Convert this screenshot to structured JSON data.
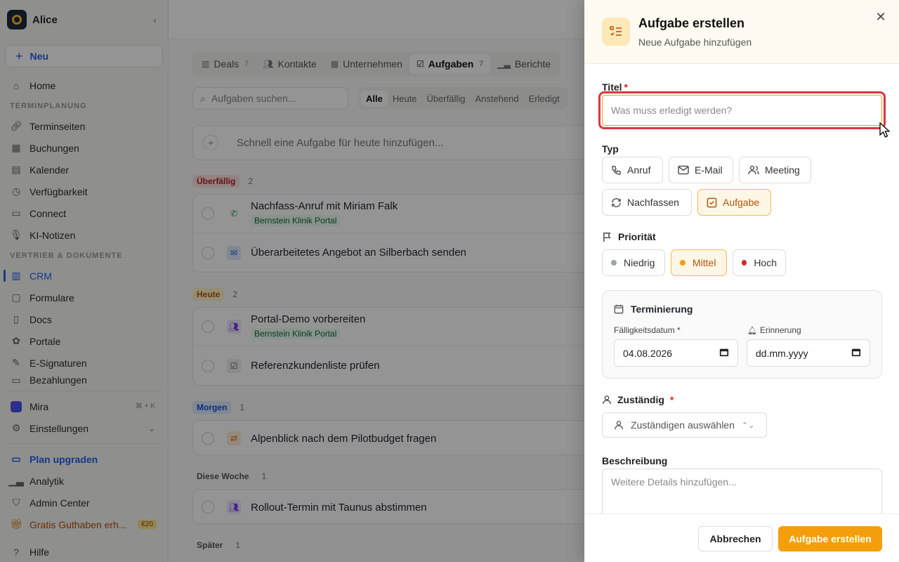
{
  "workspace": {
    "name": "Alice"
  },
  "sidebar": {
    "new_label": "Neu",
    "home": "Home",
    "section_scheduling": "TERMINPLANUNG",
    "scheduling_items": [
      "Terminseiten",
      "Buchungen",
      "Kalender",
      "Verfügbarkeit",
      "Connect",
      "KI-Notizen"
    ],
    "section_sales": "VERTRIEB & DOKUMENTE",
    "sales_items": [
      "CRM",
      "Formulare",
      "Docs",
      "Portale",
      "E-Signaturen",
      "Bezahlungen"
    ],
    "mira": "Mira",
    "mira_shortcut": "⌘ + K",
    "settings": "Einstellungen",
    "upgrade": "Plan upgraden",
    "analytics": "Analytik",
    "admin": "Admin Center",
    "credit": "Gratis Guthaben erh...",
    "credit_badge": "€20",
    "help": "Hilfe"
  },
  "crm": {
    "tabs": [
      {
        "label": "Deals",
        "count": "7"
      },
      {
        "label": "Kontakte",
        "count": ""
      },
      {
        "label": "Unternehmen",
        "count": ""
      },
      {
        "label": "Aufgaben",
        "count": "7"
      },
      {
        "label": "Berichte",
        "count": ""
      }
    ],
    "search_placeholder": "Aufgaben suchen...",
    "filters": [
      "Alle",
      "Heute",
      "Überfällig",
      "Anstehend",
      "Erledigt"
    ],
    "quick_add": "Schnell eine Aufgabe für heute hinzufügen...",
    "groups": [
      {
        "label": "Überfällig",
        "count": "2"
      },
      {
        "label": "Heute",
        "count": "2"
      },
      {
        "label": "Morgen",
        "count": "1"
      },
      {
        "label": "Diese Woche",
        "count": "1"
      },
      {
        "label": "Später",
        "count": "1"
      }
    ],
    "tasks": [
      {
        "title": "Nachfass-Anruf mit Miriam Falk",
        "tag": "Bernstein Klinik Portal"
      },
      {
        "title": "Überarbeitetes Angebot an Silberbach senden",
        "tag": ""
      },
      {
        "title": "Portal-Demo vorbereiten",
        "tag": "Bernstein Klinik Portal"
      },
      {
        "title": "Referenzkundenliste prüfen",
        "tag": ""
      },
      {
        "title": "Alpenblick nach dem Pilotbudget fragen",
        "tag": ""
      },
      {
        "title": "Rollout-Termin mit Taunus abstimmen",
        "tag": ""
      }
    ]
  },
  "panel": {
    "title": "Aufgabe erstellen",
    "subtitle": "Neue Aufgabe hinzufügen",
    "title_label": "Titel",
    "required_mark": "*",
    "title_placeholder": "Was muss erledigt werden?",
    "type_label": "Typ",
    "types": [
      "Anruf",
      "E-Mail",
      "Meeting",
      "Nachfassen",
      "Aufgabe"
    ],
    "selected_type": "Aufgabe",
    "priority_label": "Priorität",
    "priorities": [
      {
        "label": "Niedrig",
        "color": "#9ca3af"
      },
      {
        "label": "Mittel",
        "color": "#f59e0b"
      },
      {
        "label": "Hoch",
        "color": "#dc2626"
      }
    ],
    "selected_priority": "Mittel",
    "scheduling_label": "Terminierung",
    "due_label": "Fälligkeitsdatum *",
    "due_value": "04.08.2026",
    "reminder_label": "Erinnerung",
    "reminder_placeholder": "dd.mm.yyyy",
    "assignee_label": "Zuständig",
    "assignee_placeholder": "Zuständigen auswählen",
    "description_label": "Beschreibung",
    "description_placeholder": "Weitere Details hinzufügen...",
    "cancel": "Abbrechen",
    "submit": "Aufgabe erstellen"
  },
  "colors": {
    "accent": "#f59e0b",
    "link": "#2563eb",
    "error": "#dc3545"
  }
}
